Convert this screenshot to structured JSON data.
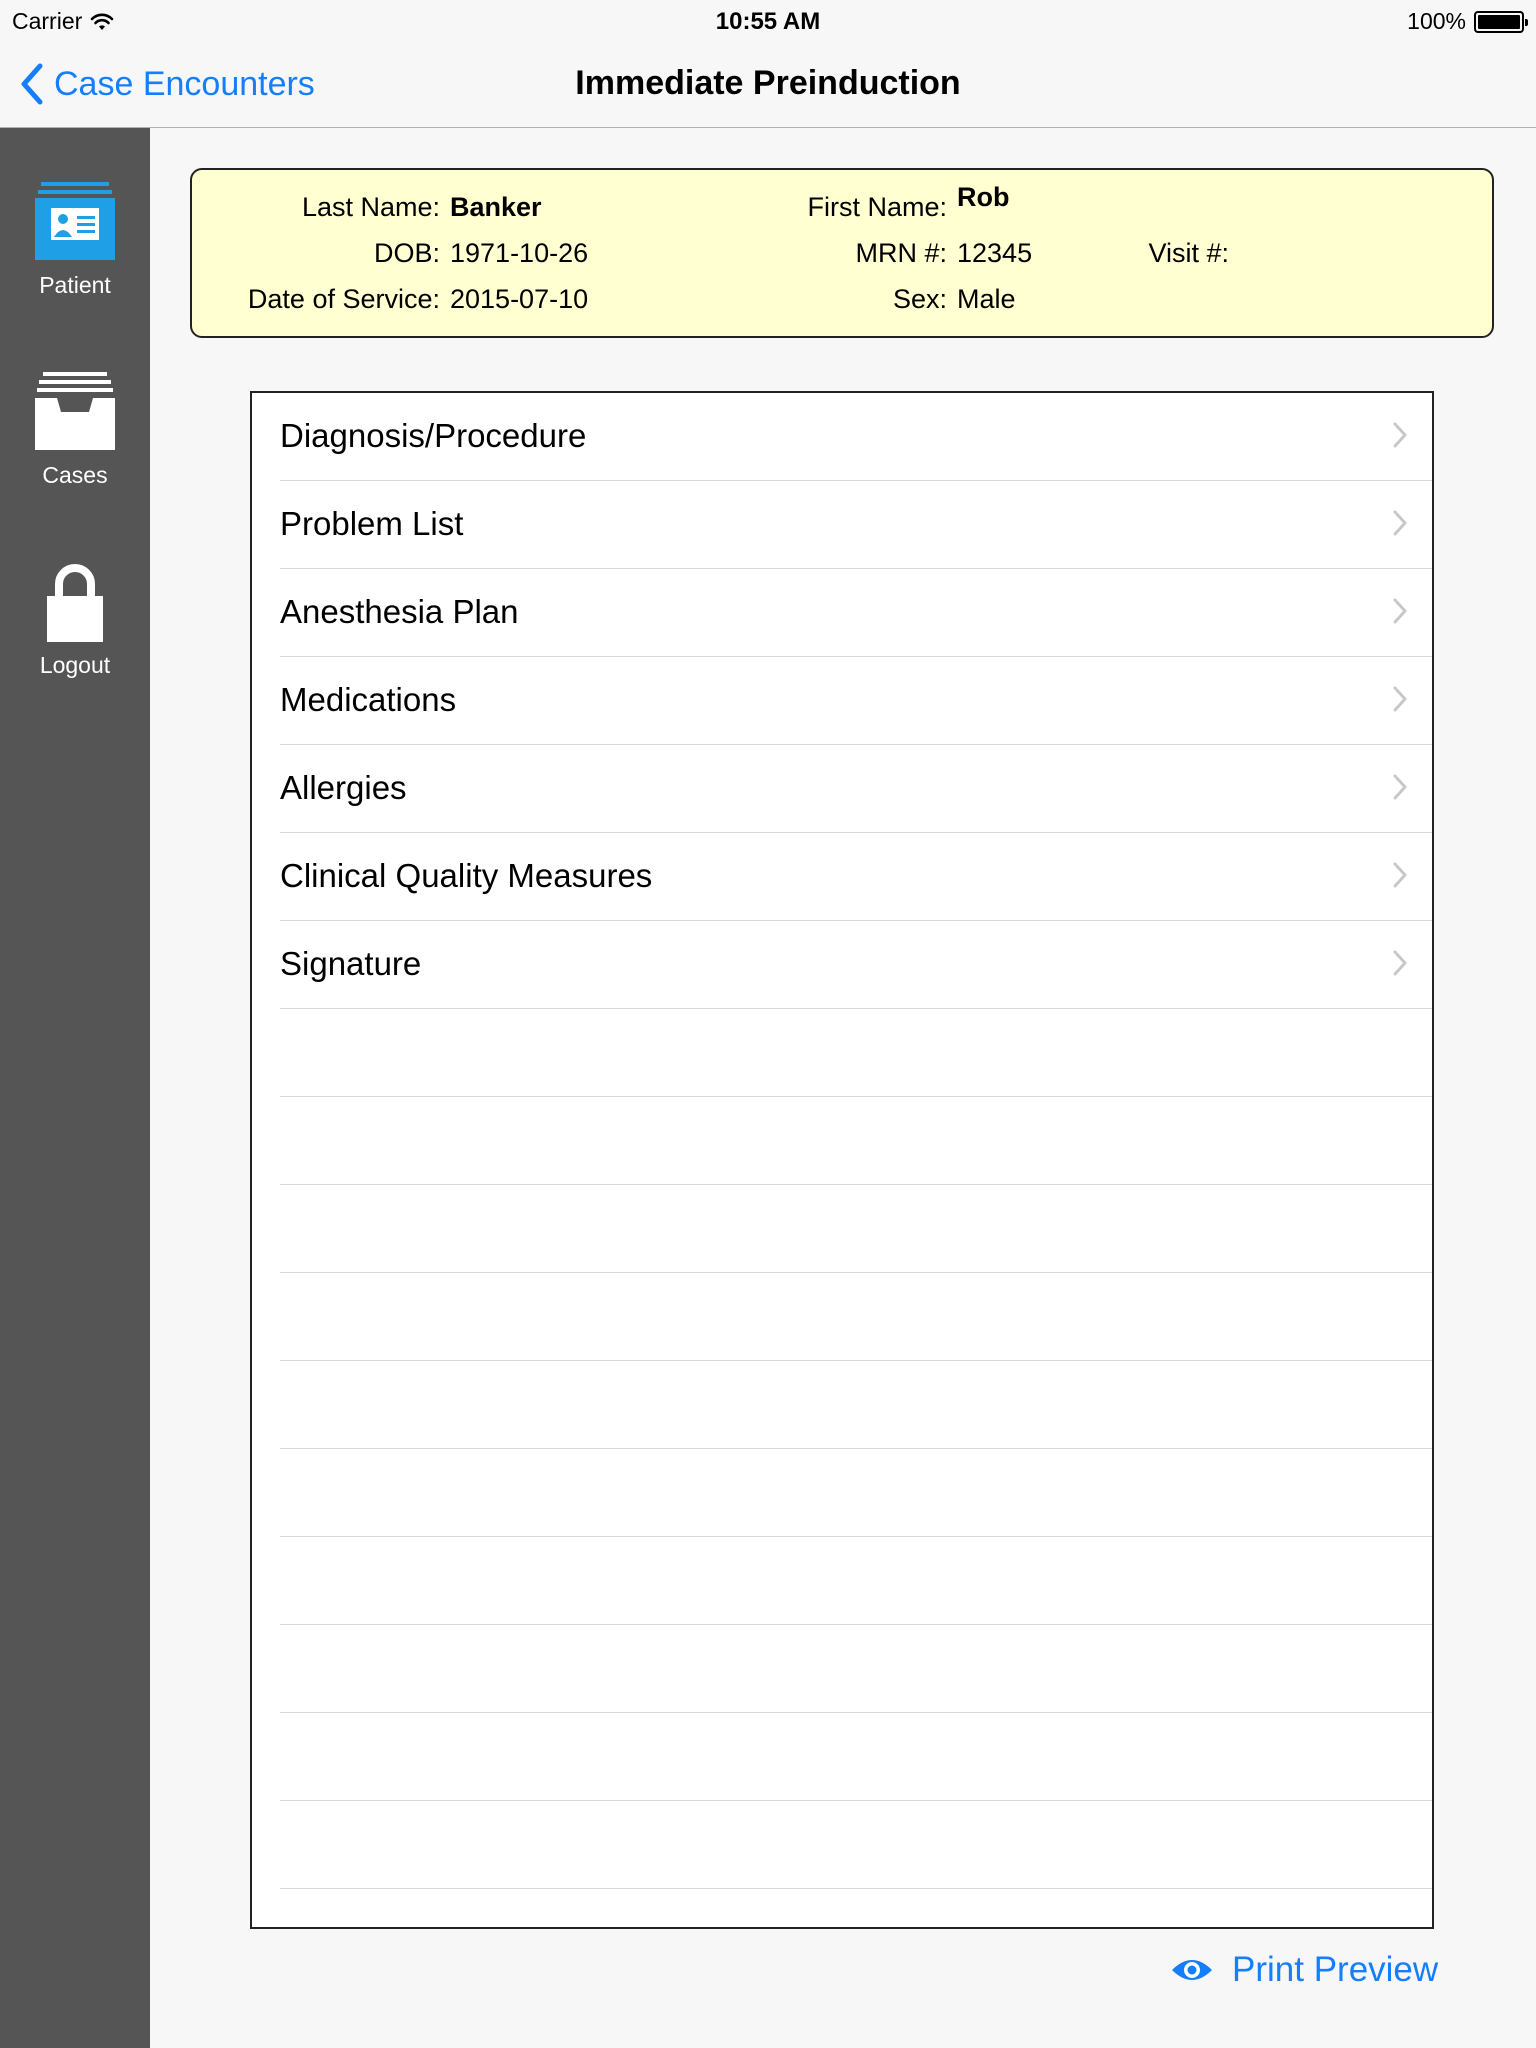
{
  "status_bar": {
    "carrier": "Carrier",
    "time": "10:55 AM",
    "battery": "100%"
  },
  "nav": {
    "back_label": "Case Encounters",
    "title": "Immediate Preinduction"
  },
  "sidebar": {
    "items": [
      {
        "label": "Patient",
        "icon": "patient-card-icon",
        "active": true
      },
      {
        "label": "Cases",
        "icon": "cases-tray-icon"
      },
      {
        "label": "Logout",
        "icon": "lock-icon"
      }
    ]
  },
  "patient": {
    "last_name_label": "Last Name:",
    "last_name": "Banker",
    "first_name_label": "First Name:",
    "first_name": "Rob",
    "dob_label": "DOB:",
    "dob": "1971-10-26",
    "mrn_label": "MRN #:",
    "mrn": "12345",
    "visit_label": "Visit #:",
    "date_of_service_label": "Date of Service:",
    "date_of_service": "2015-07-10",
    "sex_label": "Sex:",
    "sex": "Male"
  },
  "menu": {
    "items": [
      {
        "label": "Diagnosis/Procedure"
      },
      {
        "label": "Problem List"
      },
      {
        "label": "Anesthesia Plan"
      },
      {
        "label": "Medications"
      },
      {
        "label": "Allergies"
      },
      {
        "label": "Clinical Quality Measures"
      },
      {
        "label": "Signature"
      }
    ]
  },
  "footer": {
    "print_preview_label": "Print Preview"
  },
  "colors": {
    "accent": "#157efb",
    "sidebar_bg": "#555555",
    "patient_card_bg": "#ffffd2"
  }
}
